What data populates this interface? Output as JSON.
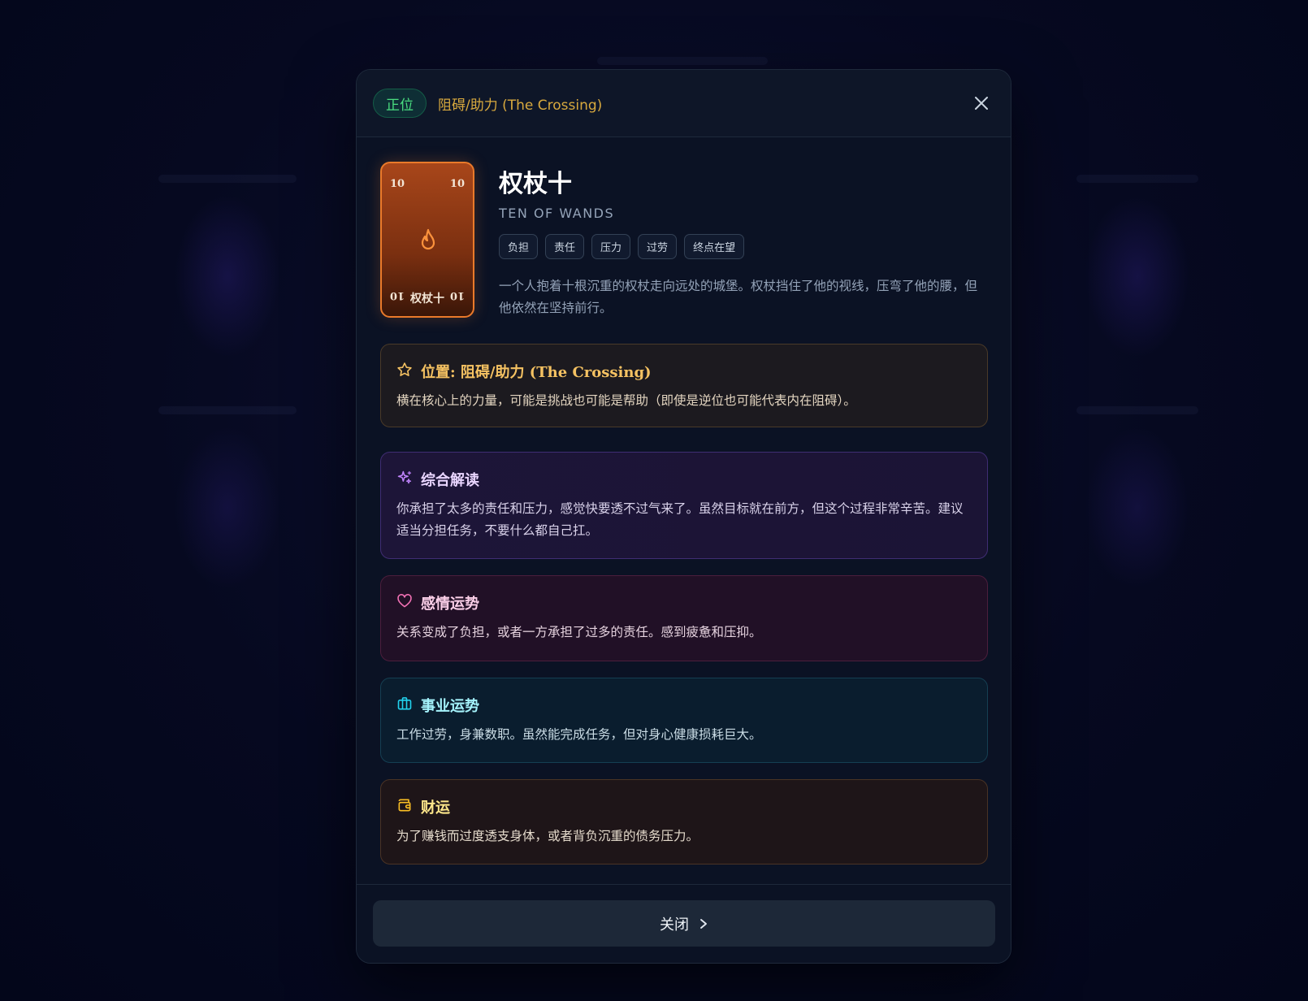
{
  "header": {
    "orientation_badge": "正位",
    "position_label": "阻碍/助力 (The Crossing)"
  },
  "card": {
    "number": "10",
    "name_zh": "权杖十",
    "name_en": "TEN OF WANDS",
    "icon": "flame-icon",
    "tags": [
      "负担",
      "责任",
      "压力",
      "过劳",
      "终点在望"
    ],
    "description": "一个人抱着十根沉重的权杖走向远处的城堡。权杖挡住了他的视线，压弯了他的腰，但他依然在坚持前行。"
  },
  "sections": {
    "position": {
      "icon": "star-icon",
      "title": "位置: 阻碍/助力 (The Crossing)",
      "body": "横在核心上的力量，可能是挑战也可能是帮助（即使是逆位也可能代表内在阻碍）。"
    },
    "overall": {
      "icon": "sparkles-icon",
      "title": "综合解读",
      "body": "你承担了太多的责任和压力，感觉快要透不过气来了。虽然目标就在前方，但这个过程非常辛苦。建议适当分担任务，不要什么都自己扛。"
    },
    "love": {
      "icon": "heart-icon",
      "title": "感情运势",
      "body": "关系变成了负担，或者一方承担了过多的责任。感到疲惫和压抑。"
    },
    "career": {
      "icon": "briefcase-icon",
      "title": "事业运势",
      "body": "工作过劳，身兼数职。虽然能完成任务，但对身心健康损耗巨大。"
    },
    "wealth": {
      "icon": "wallet-icon",
      "title": "财运",
      "body": "为了赚钱而过度透支身体，或者背负沉重的债务压力。"
    }
  },
  "footer": {
    "close_label": "关闭"
  },
  "colors": {
    "accent_gold": "#f5c262",
    "badge_green": "#4ade80",
    "card_orange": "#ea7a2a"
  }
}
